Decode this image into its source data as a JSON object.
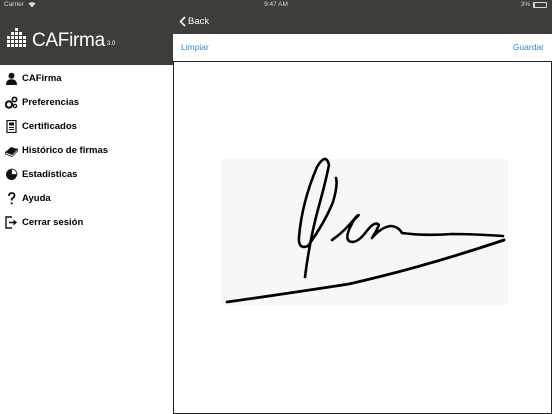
{
  "status": {
    "carrier": "Carrier",
    "time": "9:47 AM",
    "battery": "3%",
    "battery_level": 0.03
  },
  "app": {
    "name": "CAFirma",
    "version": "3.0"
  },
  "menu": [
    {
      "label": "CAFirma",
      "icon": "user-icon"
    },
    {
      "label": "Preferencias",
      "icon": "gears-icon"
    },
    {
      "label": "Certificados",
      "icon": "certificate-icon"
    },
    {
      "label": "Histórico de firmas",
      "icon": "history-icon"
    },
    {
      "label": "Estadísticas",
      "icon": "pie-chart-icon"
    },
    {
      "label": "Ayuda",
      "icon": "question-icon"
    },
    {
      "label": "Cerrar sesión",
      "icon": "logout-icon"
    }
  ],
  "nav": {
    "back_label": "Back"
  },
  "toolbar": {
    "clear_label": "Limpiar",
    "save_label": "Guardar"
  },
  "colors": {
    "header_bg": "#3d3d39",
    "link": "#2f86d8"
  }
}
